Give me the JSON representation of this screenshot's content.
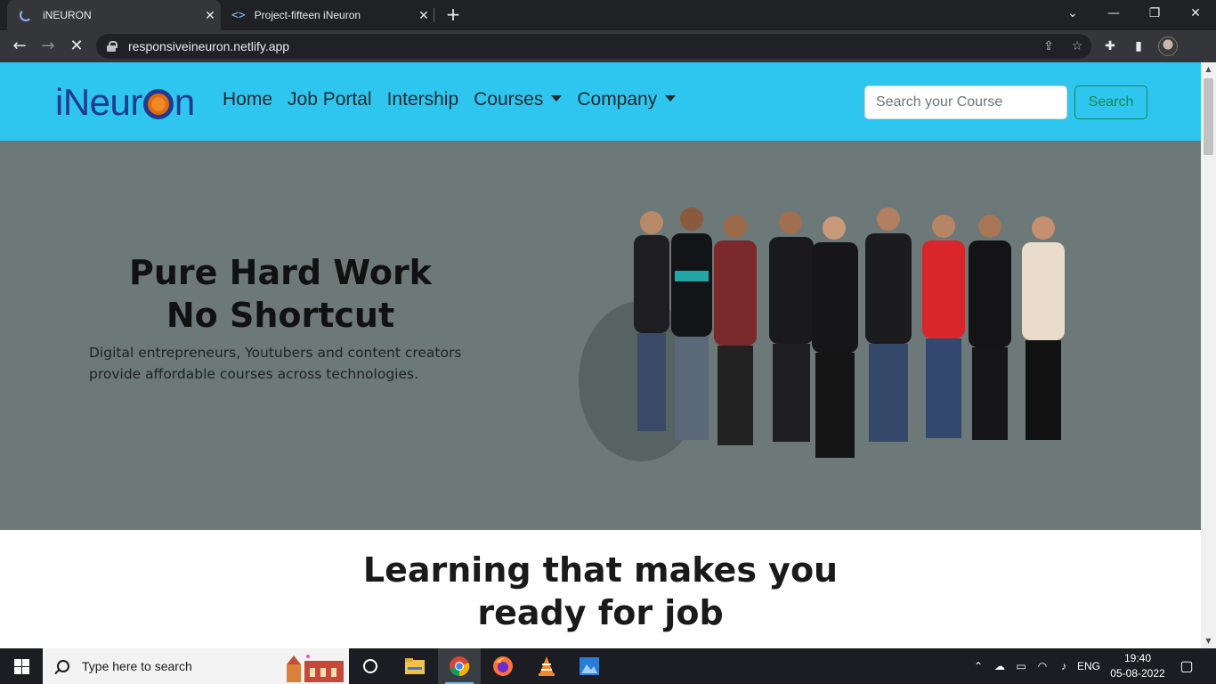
{
  "browser": {
    "tabs": [
      {
        "title": "iNEURON",
        "active": true
      },
      {
        "title": "Project-fifteen iNeuron",
        "active": false
      }
    ],
    "url": "responsiveineuron.netlify.app",
    "close_glyph": "✕",
    "new_tab_glyph": "+",
    "controls": {
      "minimize": "—",
      "restore": "❐",
      "close": "✕",
      "tab_search": "⌄"
    },
    "nav": {
      "back": "←",
      "forward": "→",
      "stop": "✕"
    },
    "icons": {
      "share": "⇪",
      "star": "☆",
      "extensions": "✚",
      "sidebar": "▮"
    }
  },
  "site": {
    "logo": {
      "prefix": "iNeur",
      "suffix": "n"
    },
    "nav": [
      "Home",
      "Job Portal",
      "Intership",
      "Courses",
      "Company"
    ],
    "search": {
      "placeholder": "Search your Course",
      "button": "Search"
    },
    "hero": {
      "title_line1": "Pure Hard Work",
      "title_line2": "No Shortcut",
      "subtitle_line1": "Digital entrepreneurs, Youtubers and content creators",
      "subtitle_line2": "provide affordable courses across technologies."
    },
    "section2": {
      "title_line1": "Learning that makes you",
      "title_line2": "ready for job"
    },
    "colors": {
      "navbar": "#2ec6ee",
      "hero_bg": "#6d7878",
      "search_btn": "#198754",
      "logo": "#1f3b8f",
      "logo_accent": "#f08a24"
    }
  },
  "taskbar": {
    "search_placeholder": "Type here to search",
    "apps": [
      "task-view-icon",
      "file-explorer-icon",
      "chrome-icon",
      "firefox-icon",
      "vlc-icon",
      "photos-icon"
    ],
    "tray": {
      "language": "ENG",
      "time": "19:40",
      "date": "05-08-2022"
    }
  }
}
